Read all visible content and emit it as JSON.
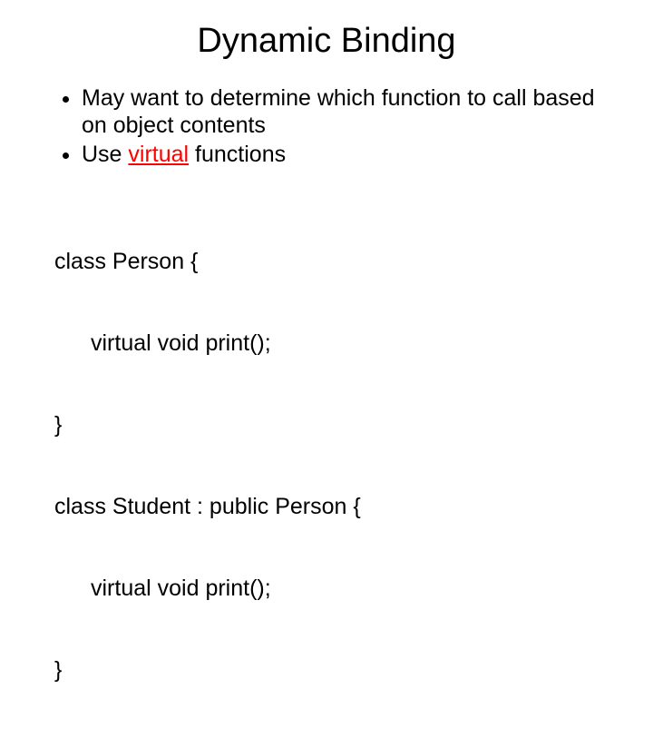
{
  "title": "Dynamic Binding",
  "bullets": {
    "b1": "May want to determine which function to call based on object contents",
    "b2_prefix": "Use ",
    "b2_virtual": "virtual",
    "b2_suffix": " functions"
  },
  "code": {
    "l1": "class Person {",
    "l2": "virtual void print();",
    "l3": "}",
    "l4": "class Student : public Person {",
    "l5": "virtual void print();",
    "l6": "}"
  }
}
